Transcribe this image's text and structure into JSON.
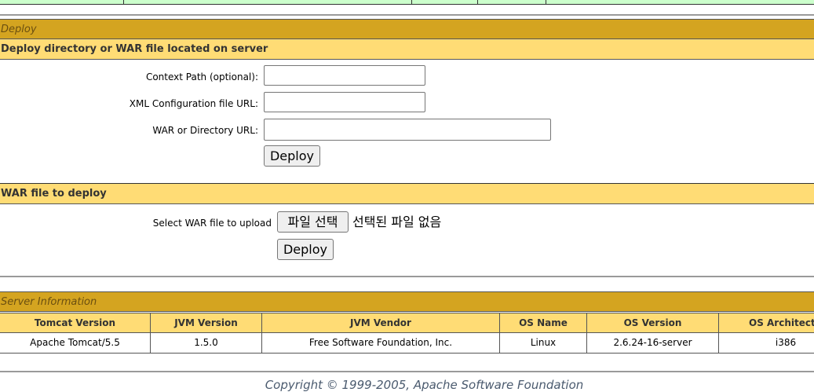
{
  "deploy": {
    "section_title": "Deploy",
    "dir_subtitle": "Deploy directory or WAR file located on server",
    "context_path_label": "Context Path (optional):",
    "xml_config_label": "XML Configuration file URL:",
    "war_dir_label": "WAR or Directory URL:",
    "context_path_value": "",
    "xml_config_value": "",
    "war_dir_value": "",
    "deploy_button": "Deploy",
    "war_subtitle": "WAR file to deploy",
    "select_war_label": "Select WAR file to upload",
    "choose_file_button": "파일 선택",
    "no_file_text": "선택된 파일 없음",
    "upload_deploy_button": "Deploy"
  },
  "server_info": {
    "section_title": "Server Information",
    "headers": [
      "Tomcat Version",
      "JVM Version",
      "JVM Vendor",
      "OS Name",
      "OS Version",
      "OS Architecture"
    ],
    "values": [
      "Apache Tomcat/5.5",
      "1.5.0",
      "Free Software Foundation, Inc.",
      "Linux",
      "2.6.24-16-server",
      "i386"
    ]
  },
  "footer": {
    "copyright": "Copyright © 1999-2005, Apache Software Foundation"
  },
  "colors": {
    "section_bg": "#d4a420",
    "subsection_bg": "#ffdc75",
    "prev_row_bg": "#ccffcc"
  }
}
